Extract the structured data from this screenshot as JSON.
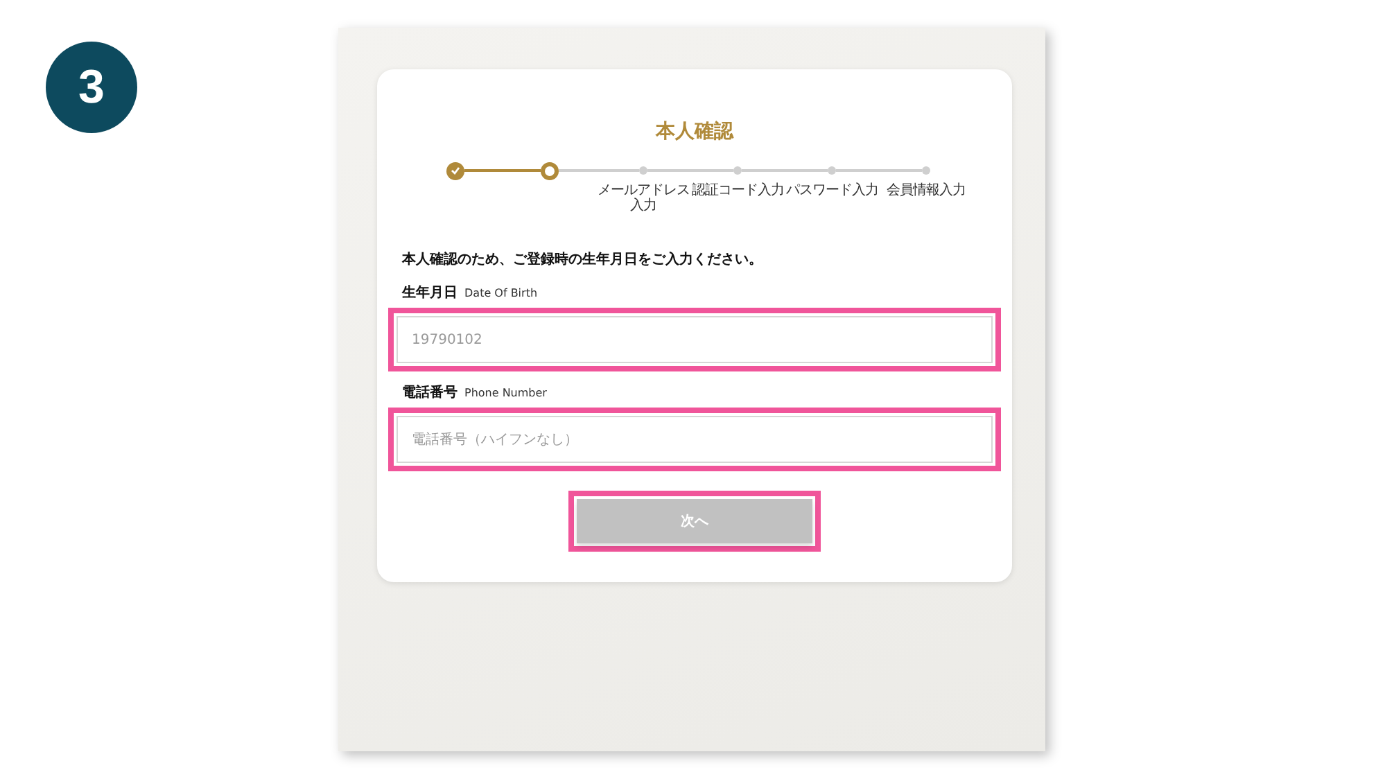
{
  "step_badge": "3",
  "title": "本人確認",
  "steps": [
    {
      "kind": "done"
    },
    {
      "kind": "current"
    },
    {
      "kind": "pending",
      "label": "メールアドレス入力"
    },
    {
      "kind": "pending",
      "label": "認証コード入力"
    },
    {
      "kind": "pending",
      "label": "パスワード入力"
    },
    {
      "kind": "pending",
      "label": "会員情報入力"
    }
  ],
  "instruction": "本人確認のため、ご登録時の生年月日をご入力ください。",
  "fields": [
    {
      "label": "生年月日",
      "sublabel": "Date Of Birth",
      "placeholder": "19790102",
      "highlighted": true
    },
    {
      "label": "電話番号",
      "sublabel": "Phone Number",
      "placeholder": "電話番号（ハイフンなし）",
      "highlighted": true
    }
  ],
  "next_button": {
    "label": "次へ",
    "disabled": true,
    "highlighted": true
  }
}
